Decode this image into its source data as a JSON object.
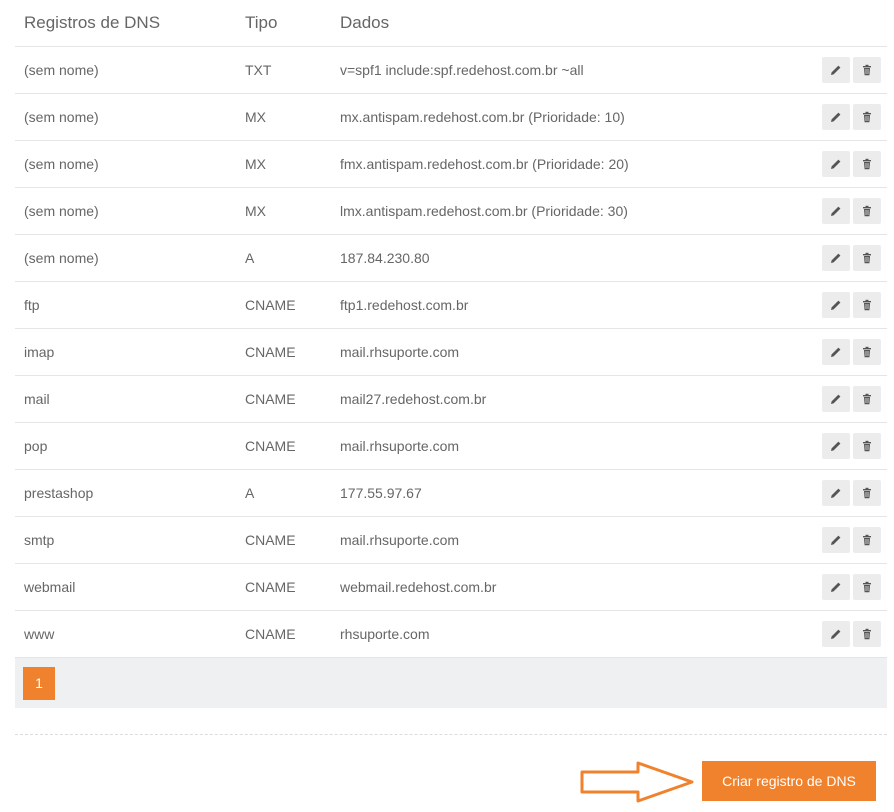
{
  "table": {
    "headers": {
      "name": "Registros de DNS",
      "type": "Tipo",
      "data": "Dados"
    },
    "rows": [
      {
        "name": "(sem nome)",
        "type": "TXT",
        "data": "v=spf1 include:spf.redehost.com.br ~all"
      },
      {
        "name": "(sem nome)",
        "type": "MX",
        "data": "mx.antispam.redehost.com.br (Prioridade: 10)"
      },
      {
        "name": "(sem nome)",
        "type": "MX",
        "data": "fmx.antispam.redehost.com.br (Prioridade: 20)"
      },
      {
        "name": "(sem nome)",
        "type": "MX",
        "data": "lmx.antispam.redehost.com.br (Prioridade: 30)"
      },
      {
        "name": "(sem nome)",
        "type": "A",
        "data": "187.84.230.80"
      },
      {
        "name": "ftp",
        "type": "CNAME",
        "data": "ftp1.redehost.com.br"
      },
      {
        "name": "imap",
        "type": "CNAME",
        "data": "mail.rhsuporte.com"
      },
      {
        "name": "mail",
        "type": "CNAME",
        "data": "mail27.redehost.com.br"
      },
      {
        "name": "pop",
        "type": "CNAME",
        "data": "mail.rhsuporte.com"
      },
      {
        "name": "prestashop",
        "type": "A",
        "data": "177.55.97.67"
      },
      {
        "name": "smtp",
        "type": "CNAME",
        "data": "mail.rhsuporte.com"
      },
      {
        "name": "webmail",
        "type": "CNAME",
        "data": "webmail.redehost.com.br"
      },
      {
        "name": "www",
        "type": "CNAME",
        "data": "rhsuporte.com"
      }
    ],
    "row_actions": {
      "edit_icon": "pencil-icon",
      "delete_icon": "trash-icon"
    }
  },
  "pagination": {
    "current_page": "1"
  },
  "create_button": {
    "label": "Criar registro de DNS"
  },
  "colors": {
    "accent": "#f0822e",
    "arrow": "#f0822e",
    "pager_bg": "#eef0f1",
    "icon_button_bg": "#ececec"
  }
}
